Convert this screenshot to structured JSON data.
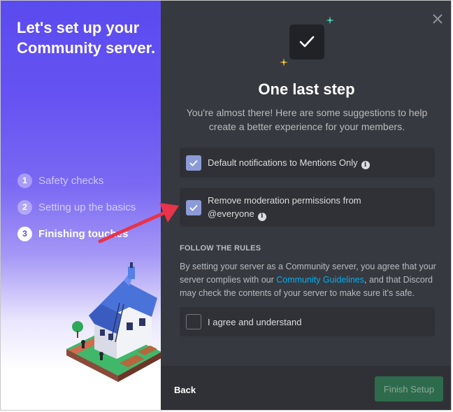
{
  "left": {
    "title": "Let's set up your Community server.",
    "steps": [
      {
        "num": "1",
        "label": "Safety checks",
        "state": "done"
      },
      {
        "num": "2",
        "label": "Setting up the basics",
        "state": "done"
      },
      {
        "num": "3",
        "label": "Finishing touches",
        "state": "active"
      }
    ]
  },
  "main": {
    "heading": "One last step",
    "subtitle": "You're almost there! Here are some suggestions to help create a better experience for your members.",
    "options": [
      {
        "label": "Default notifications to Mentions Only",
        "checked": true
      },
      {
        "line1": "Remove moderation permissions from",
        "line2": "@everyone",
        "checked": true
      }
    ],
    "rules": {
      "heading": "FOLLOW THE RULES",
      "text_before": "By setting your server as a Community server, you agree that your server complies with our ",
      "link": "Community Guidelines",
      "text_after": ", and that Discord may check the contents of your server to make sure it's safe.",
      "agree_label": "I agree and understand",
      "agree_checked": false
    },
    "icons": {
      "close": "close-icon",
      "check": "checkmark-icon",
      "info": "info-icon"
    },
    "info_glyph": "i"
  },
  "footer": {
    "back_label": "Back",
    "finish_label": "Finish Setup"
  },
  "colors": {
    "accent_purple": "#5a4bf0",
    "checkbox": "#8c9bd8",
    "panel_bg": "#36393f",
    "card_bg": "#2f3136",
    "finish_button": "#2d6b4c",
    "link": "#00aff4",
    "annotation_arrow": "#e8334a"
  }
}
